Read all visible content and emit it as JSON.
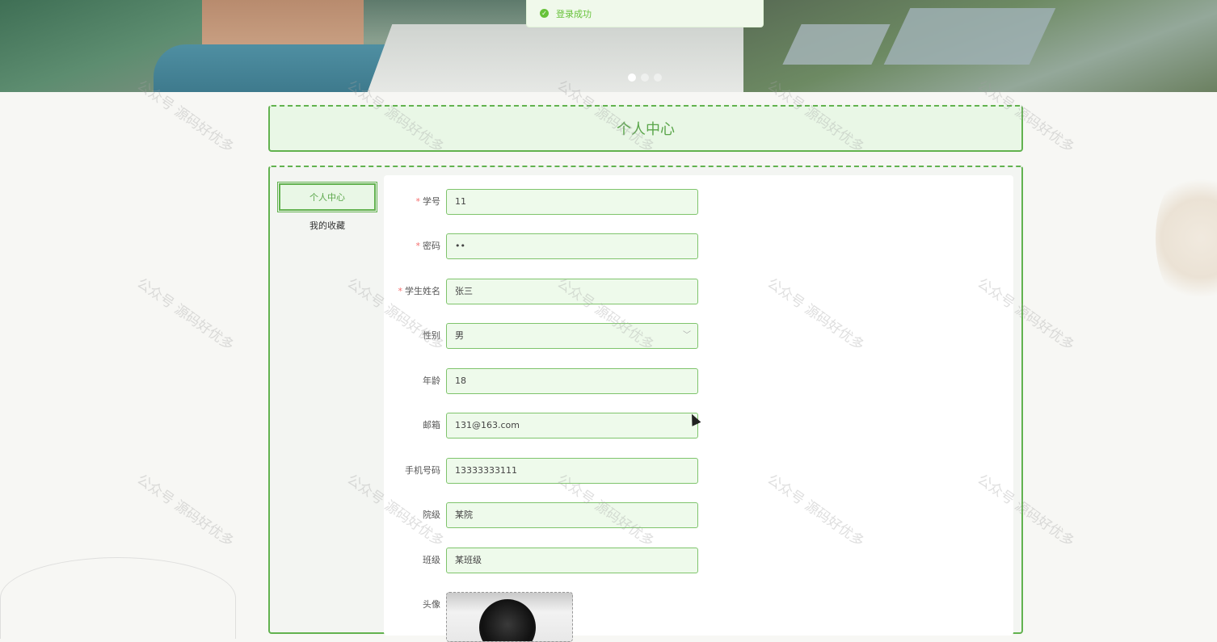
{
  "toast": {
    "message": "登录成功",
    "icon": "check-circle-icon",
    "color": "#67c23a"
  },
  "banner": {
    "slides": 3,
    "active_slide": 1
  },
  "page": {
    "title": "个人中心"
  },
  "menu": {
    "items": [
      {
        "label": "个人中心",
        "active": true
      },
      {
        "label": "我的收藏",
        "active": false
      }
    ]
  },
  "form": {
    "fields": [
      {
        "label": "学号",
        "required": true,
        "value": "11"
      },
      {
        "label": "密码",
        "required": true,
        "value": "••"
      },
      {
        "label": "学生姓名",
        "required": true,
        "value": "张三"
      },
      {
        "label": "性别",
        "required": false,
        "value": "男",
        "type": "select"
      },
      {
        "label": "年龄",
        "required": false,
        "value": "18"
      },
      {
        "label": "邮箱",
        "required": false,
        "value": "131@163.com"
      },
      {
        "label": "手机号码",
        "required": false,
        "value": "13333333111"
      },
      {
        "label": "院级",
        "required": false,
        "value": "某院"
      },
      {
        "label": "班级",
        "required": false,
        "value": "某班级"
      }
    ],
    "avatar_label": "头像"
  },
  "watermark": "公众号 源码好优多",
  "colors": {
    "accent": "#62b24f",
    "input_bg": "#eefaeb",
    "required": "#f56c6c"
  }
}
